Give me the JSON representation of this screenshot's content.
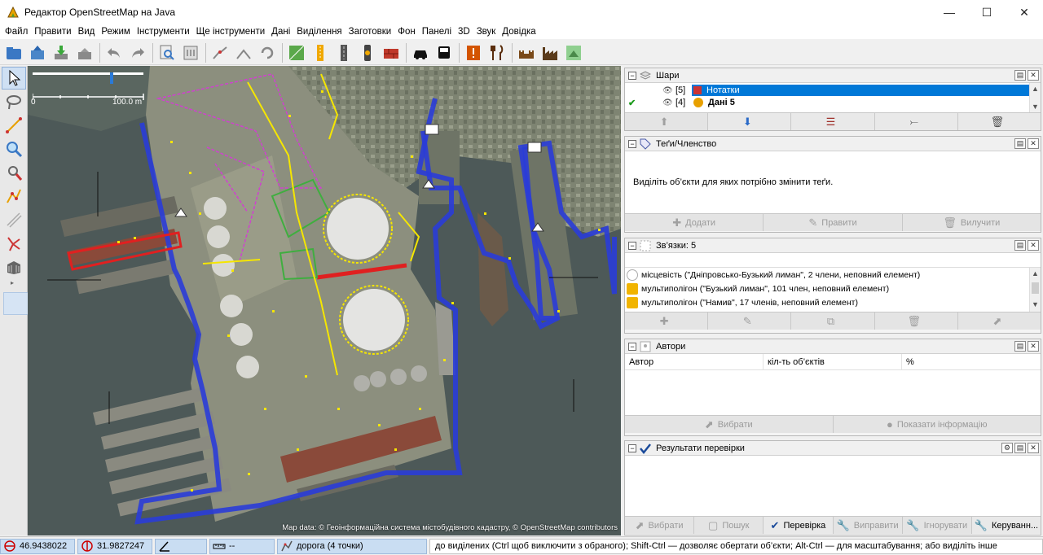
{
  "window": {
    "title": "Редактор OpenStreetMap на Java"
  },
  "menu": [
    "Файл",
    "Правити",
    "Вид",
    "Режим",
    "Інструменти",
    "Ще інструменти",
    "Дані",
    "Виділення",
    "Заготовки",
    "Фон",
    "Панелі",
    "3D",
    "Звук",
    "Довідка"
  ],
  "map": {
    "scale_zero": "0",
    "scale_label": "100.0 m",
    "attribution": "Map data: © Геоінформаційна система містобудівного кадастру, © OpenStreetMap contributors"
  },
  "layers": {
    "title": "Шари",
    "rows": [
      {
        "index": "[5]",
        "name": "Нотатки",
        "selected": true
      },
      {
        "index": "[4]",
        "name": "Дані 5",
        "selected": false
      }
    ]
  },
  "tags": {
    "title": "Теґи/Членство",
    "message": "Виділіть об’єкти для яких потрібно змінити теґи.",
    "buttons": [
      "Додати",
      "Правити",
      "Вилучити"
    ]
  },
  "relations": {
    "title": "Зв’язки: 5",
    "rows": [
      "місцевість (\"Дніпровсько-Бузький лиман\", 2 члени, неповний елемент)",
      "мультиполігон (\"Бузький лиман\", 101 член, неповний елемент)",
      "мультиполігон (\"Намив\", 17 членів, неповний елемент)"
    ]
  },
  "authors": {
    "title": "Автори",
    "columns": [
      "Автор",
      "кіл-ть об’єктів",
      "%"
    ],
    "buttons": [
      "Вибрати",
      "Показати інформацію"
    ]
  },
  "validation": {
    "title": "Результати перевірки",
    "buttons": [
      "Вибрати",
      "Пошук",
      "Перевірка",
      "Виправити",
      "Ігнорувати",
      "Керуванн..."
    ]
  },
  "status": {
    "lat": "46.9438022",
    "lon": "31.9827247",
    "dist": "--",
    "object": "дорога (4 точки)",
    "help": "до виділених (Ctrl щоб виключити з обраного); Shift-Ctrl — дозволяє обертати об’єкти; Alt-Ctrl — для масштабування; або виділіть інше"
  },
  "colors": {
    "selection_blue": "#2a3cd8",
    "node_yellow": "#f5e600",
    "highlight_red": "#e02020",
    "accent": "#0078d7"
  }
}
